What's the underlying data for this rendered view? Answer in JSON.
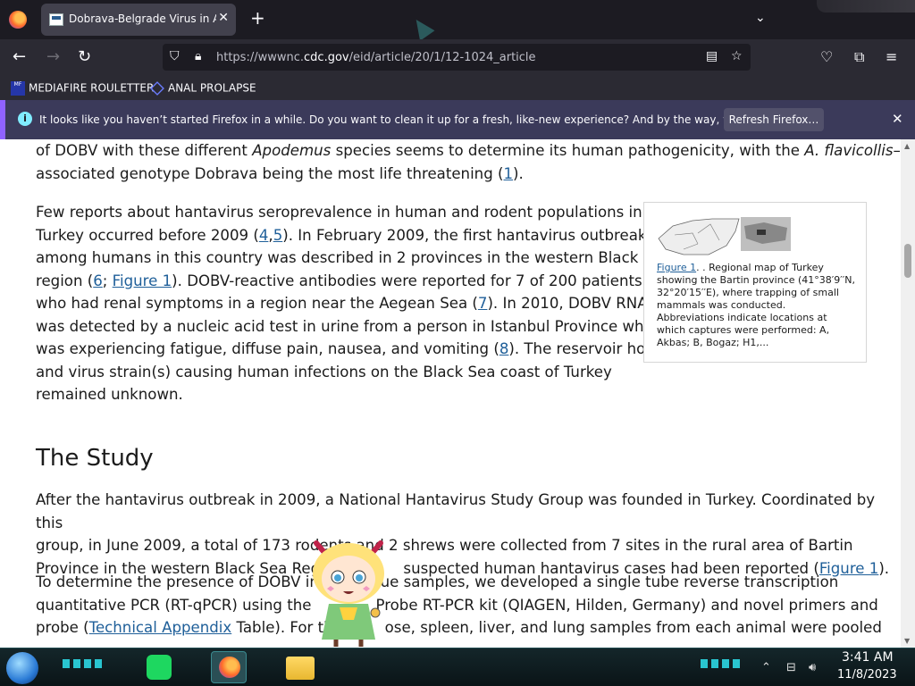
{
  "browser": {
    "tab": {
      "title": "Dobrava-Belgrade Virus in Apodemus"
    },
    "url": {
      "prefix": "https://wwwnc.",
      "domain": "cdc.gov",
      "path": "/eid/article/20/1/12-1024_article"
    },
    "bookmarks": [
      {
        "label": "MEDIAFIRE ROULETTER",
        "icon": "mediafire-icon"
      },
      {
        "label": "ANAL PROLAPSE",
        "icon": "bookmark-diamond-icon"
      }
    ],
    "notification": {
      "text": "It looks like you haven’t started Firefox in a while. Do you want to clean it up for a fresh, like-new experience? And by the way, welcome back!",
      "button": "Refresh Firefox…"
    }
  },
  "article": {
    "p0": {
      "line1_a": "of DOBV with these different ",
      "line1_i1": "Apodemus",
      "line1_b": " species seems to determine its human pathogenicity, with the ",
      "line1_i2": "A. flavicollis",
      "line1_c": "–",
      "line2_a": "associated genotype Dobrava being the most life threatening (",
      "ref1": "1",
      "line2_b": ")."
    },
    "p1": {
      "l1": "Few reports about hantavirus seroprevalence in human and rodent populations in",
      "l2_a": "Turkey occurred before 2009 (",
      "ref4": "4",
      "sep": ",",
      "ref5": "5",
      "l2_b": "). In February 2009, the first hantavirus outbreak",
      "l3": "among humans in this country was described in 2 provinces in the western Black Sea",
      "l4_a": "region (",
      "ref6": "6",
      "l4_sep": "; ",
      "fig1": "Figure 1",
      "l4_b": "). DOBV-reactive antibodies were reported for 7 of 200 patients",
      "l5_a": "who had renal symptoms in a region near the Aegean Sea (",
      "ref7": "7",
      "l5_b": "). In 2010, DOBV RNA",
      "l6": "was detected by a nucleic acid test in urine from a person in Istanbul Province who",
      "l7_a": "was experiencing fatigue, diffuse pain, nausea, and vomiting (",
      "ref8": "8",
      "l7_b": "). The reservoir host(s)",
      "l8": "and virus strain(s) causing human infections on the Black Sea coast of Turkey",
      "l9": "remained unknown."
    },
    "figure": {
      "link": "Figure 1",
      "caption": ". . Regional map of Turkey showing the Bartin province (41°38′9′′N, 32°20′15′′E), where trapping of small mammals was conducted. Abbreviations indicate locations at which captures were performed: A, Akbas; B, Bogaz; H1,..."
    },
    "heading": "The Study",
    "p2": {
      "l1": "After the hantavirus outbreak in 2009, a National Hantavirus Study Group was founded in Turkey. Coordinated by this",
      "l2": "group, in June 2009, a total of 173 rodents and 2 shrews were collected from 7 sites in the rural area of Bartin",
      "l3_a": "Province in the western Black Sea Region",
      "l3_b": "suspected human hantavirus cases had been reported (",
      "fig1": "Figure 1",
      "l3_c": ")."
    },
    "p3": {
      "l1_a": "To determine the presence of DOBV in",
      "l1_b": "sue samples, we developed a single tube reverse transcription",
      "l2_a": "quantitative PCR (RT-qPCR) using the",
      "l2_b": "Probe RT-PCR kit (QIAGEN, Hilden, Germany) and novel primers and",
      "l3_a": "probe (",
      "tech": "Technical Appendix",
      "l3_b": " Table). For th",
      "l3_c": "ose, spleen, liver, and lung samples from each animal were pooled"
    }
  },
  "taskbar": {
    "time": "3:41 AM",
    "date": "11/8/2023"
  }
}
